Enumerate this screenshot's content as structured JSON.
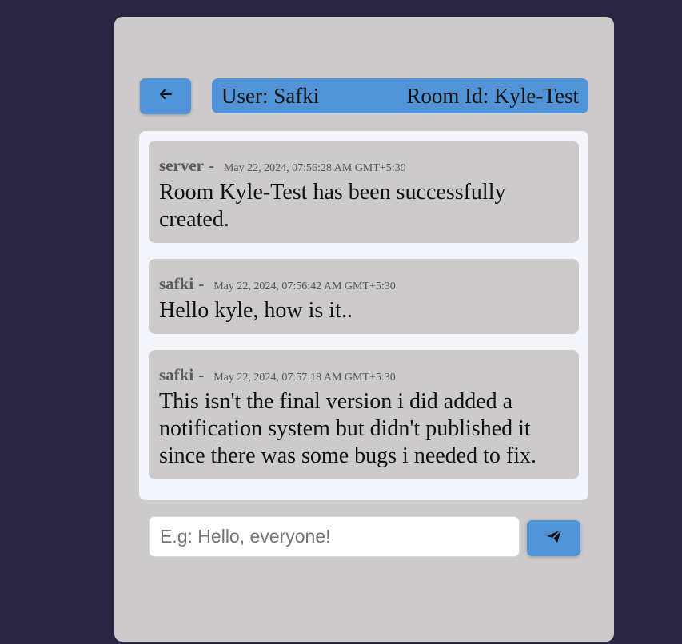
{
  "header": {
    "user_label": "User: Safki",
    "room_label": "Room Id: Kyle-Test"
  },
  "icons": {
    "back": "arrow-left-icon",
    "send": "paper-plane-icon"
  },
  "colors": {
    "page_background": "#292442",
    "card_background": "#cdcacc",
    "accent": "#5193d7",
    "messages_panel": "#f4f5fa"
  },
  "messages": [
    {
      "sender": "server",
      "separator": "-",
      "time": "May 22, 2024, 07:56:28 AM GMT+5:30",
      "text": "Room Kyle-Test has been successfully created."
    },
    {
      "sender": "safki",
      "separator": "-",
      "time": "May 22, 2024, 07:56:42 AM GMT+5:30",
      "text": "Hello kyle, how is it.."
    },
    {
      "sender": "safki",
      "separator": "-",
      "time": "May 22, 2024, 07:57:18 AM GMT+5:30",
      "text": "This isn't the final version i did added a notification system but didn't published it since there was some bugs i needed to fix."
    }
  ],
  "composer": {
    "placeholder": "E.g: Hello, everyone!",
    "value": ""
  }
}
